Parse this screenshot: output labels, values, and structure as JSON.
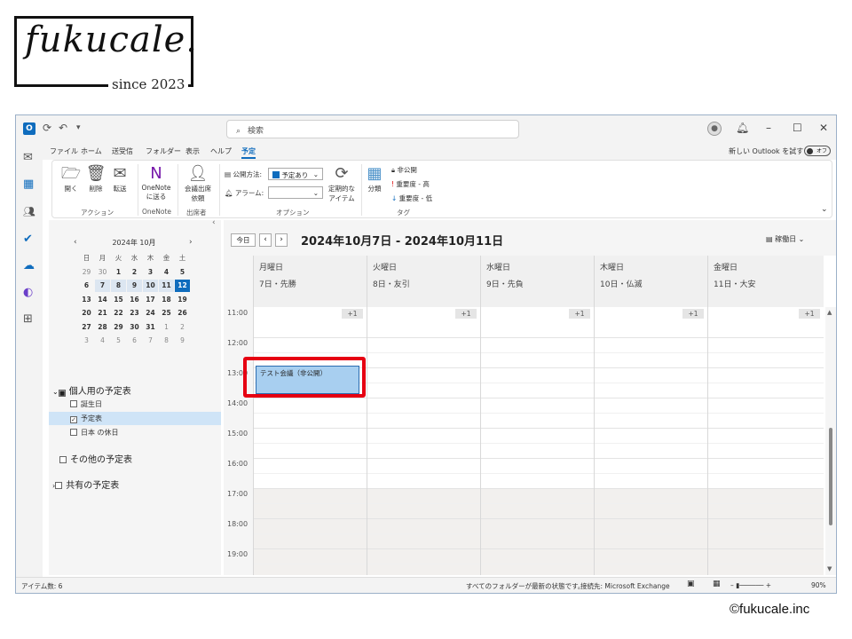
{
  "branding": {
    "logo_text": "fukucale.",
    "since": "since 2023",
    "copyright": "©fukucale.inc"
  },
  "titlebar": {
    "search_placeholder": "検索"
  },
  "menu": {
    "tabs": [
      "ファイル",
      "ホーム",
      "送受信",
      "フォルダー",
      "表示",
      "ヘルプ",
      "予定"
    ],
    "active_tab": "予定",
    "new_outlook_label": "新しい Outlook を試す",
    "toggle_label": "オフ"
  },
  "ribbon": {
    "open": "開く",
    "delete": "削除",
    "forward": "転送",
    "onenote_line1": "OneNote",
    "onenote_line2": "に送る",
    "attendance_line1": "会議出席",
    "attendance_line2": "依頼",
    "show_as_label": "公開方法:",
    "show_as_value": "予定あり",
    "alarm_label": "アラーム:",
    "recurrence_line1": "定期的な",
    "recurrence_line2": "アイテム",
    "categorize": "分類",
    "private": "非公開",
    "high_importance": "重要度 - 高",
    "low_importance": "重要度 - 低",
    "groups": [
      "アクション",
      "OneNote",
      "出席者",
      "オプション",
      "タグ"
    ]
  },
  "mini_calendar": {
    "title": "2024年 10月",
    "weekdays": [
      "日",
      "月",
      "火",
      "水",
      "木",
      "金",
      "土"
    ],
    "weeks": [
      [
        "29",
        "30",
        "1",
        "2",
        "3",
        "4",
        "5"
      ],
      [
        "6",
        "7",
        "8",
        "9",
        "10",
        "11",
        "12"
      ],
      [
        "13",
        "14",
        "15",
        "16",
        "17",
        "18",
        "19"
      ],
      [
        "20",
        "21",
        "22",
        "23",
        "24",
        "25",
        "26"
      ],
      [
        "27",
        "28",
        "29",
        "30",
        "31",
        "1",
        "2"
      ],
      [
        "3",
        "4",
        "5",
        "6",
        "7",
        "8",
        "9"
      ]
    ]
  },
  "folders": {
    "my_calendars": "個人用の予定表",
    "items": [
      "誕生日",
      "予定表",
      "日本 の休日"
    ],
    "other_calendars": "その他の予定表",
    "shared_calendars": "共有の予定表"
  },
  "calendar": {
    "today_button": "今日",
    "range_title": "2024年10月7日 - 2024年10月11日",
    "view_label": "稼働日",
    "days": [
      {
        "name": "月曜日",
        "sub": "7日・先勝"
      },
      {
        "name": "火曜日",
        "sub": "8日・友引"
      },
      {
        "name": "水曜日",
        "sub": "9日・先負"
      },
      {
        "name": "木曜日",
        "sub": "10日・仏滅"
      },
      {
        "name": "金曜日",
        "sub": "11日・大安"
      }
    ],
    "more_label": "+1",
    "times": [
      "11:00",
      "12:00",
      "13:00",
      "14:00",
      "15:00",
      "16:00",
      "17:00",
      "18:00",
      "19:00"
    ],
    "event_title": "テスト会議（非公開）"
  },
  "statusbar": {
    "item_count": "アイテム数: 6",
    "folders_status": "すべてのフォルダーが最新の状態です。",
    "connection": "接続先: Microsoft Exchange",
    "zoom": "90%"
  },
  "colors": {
    "accent": "#0f6cbd",
    "event_fill": "#a8cff0",
    "highlight": "#e60012"
  }
}
